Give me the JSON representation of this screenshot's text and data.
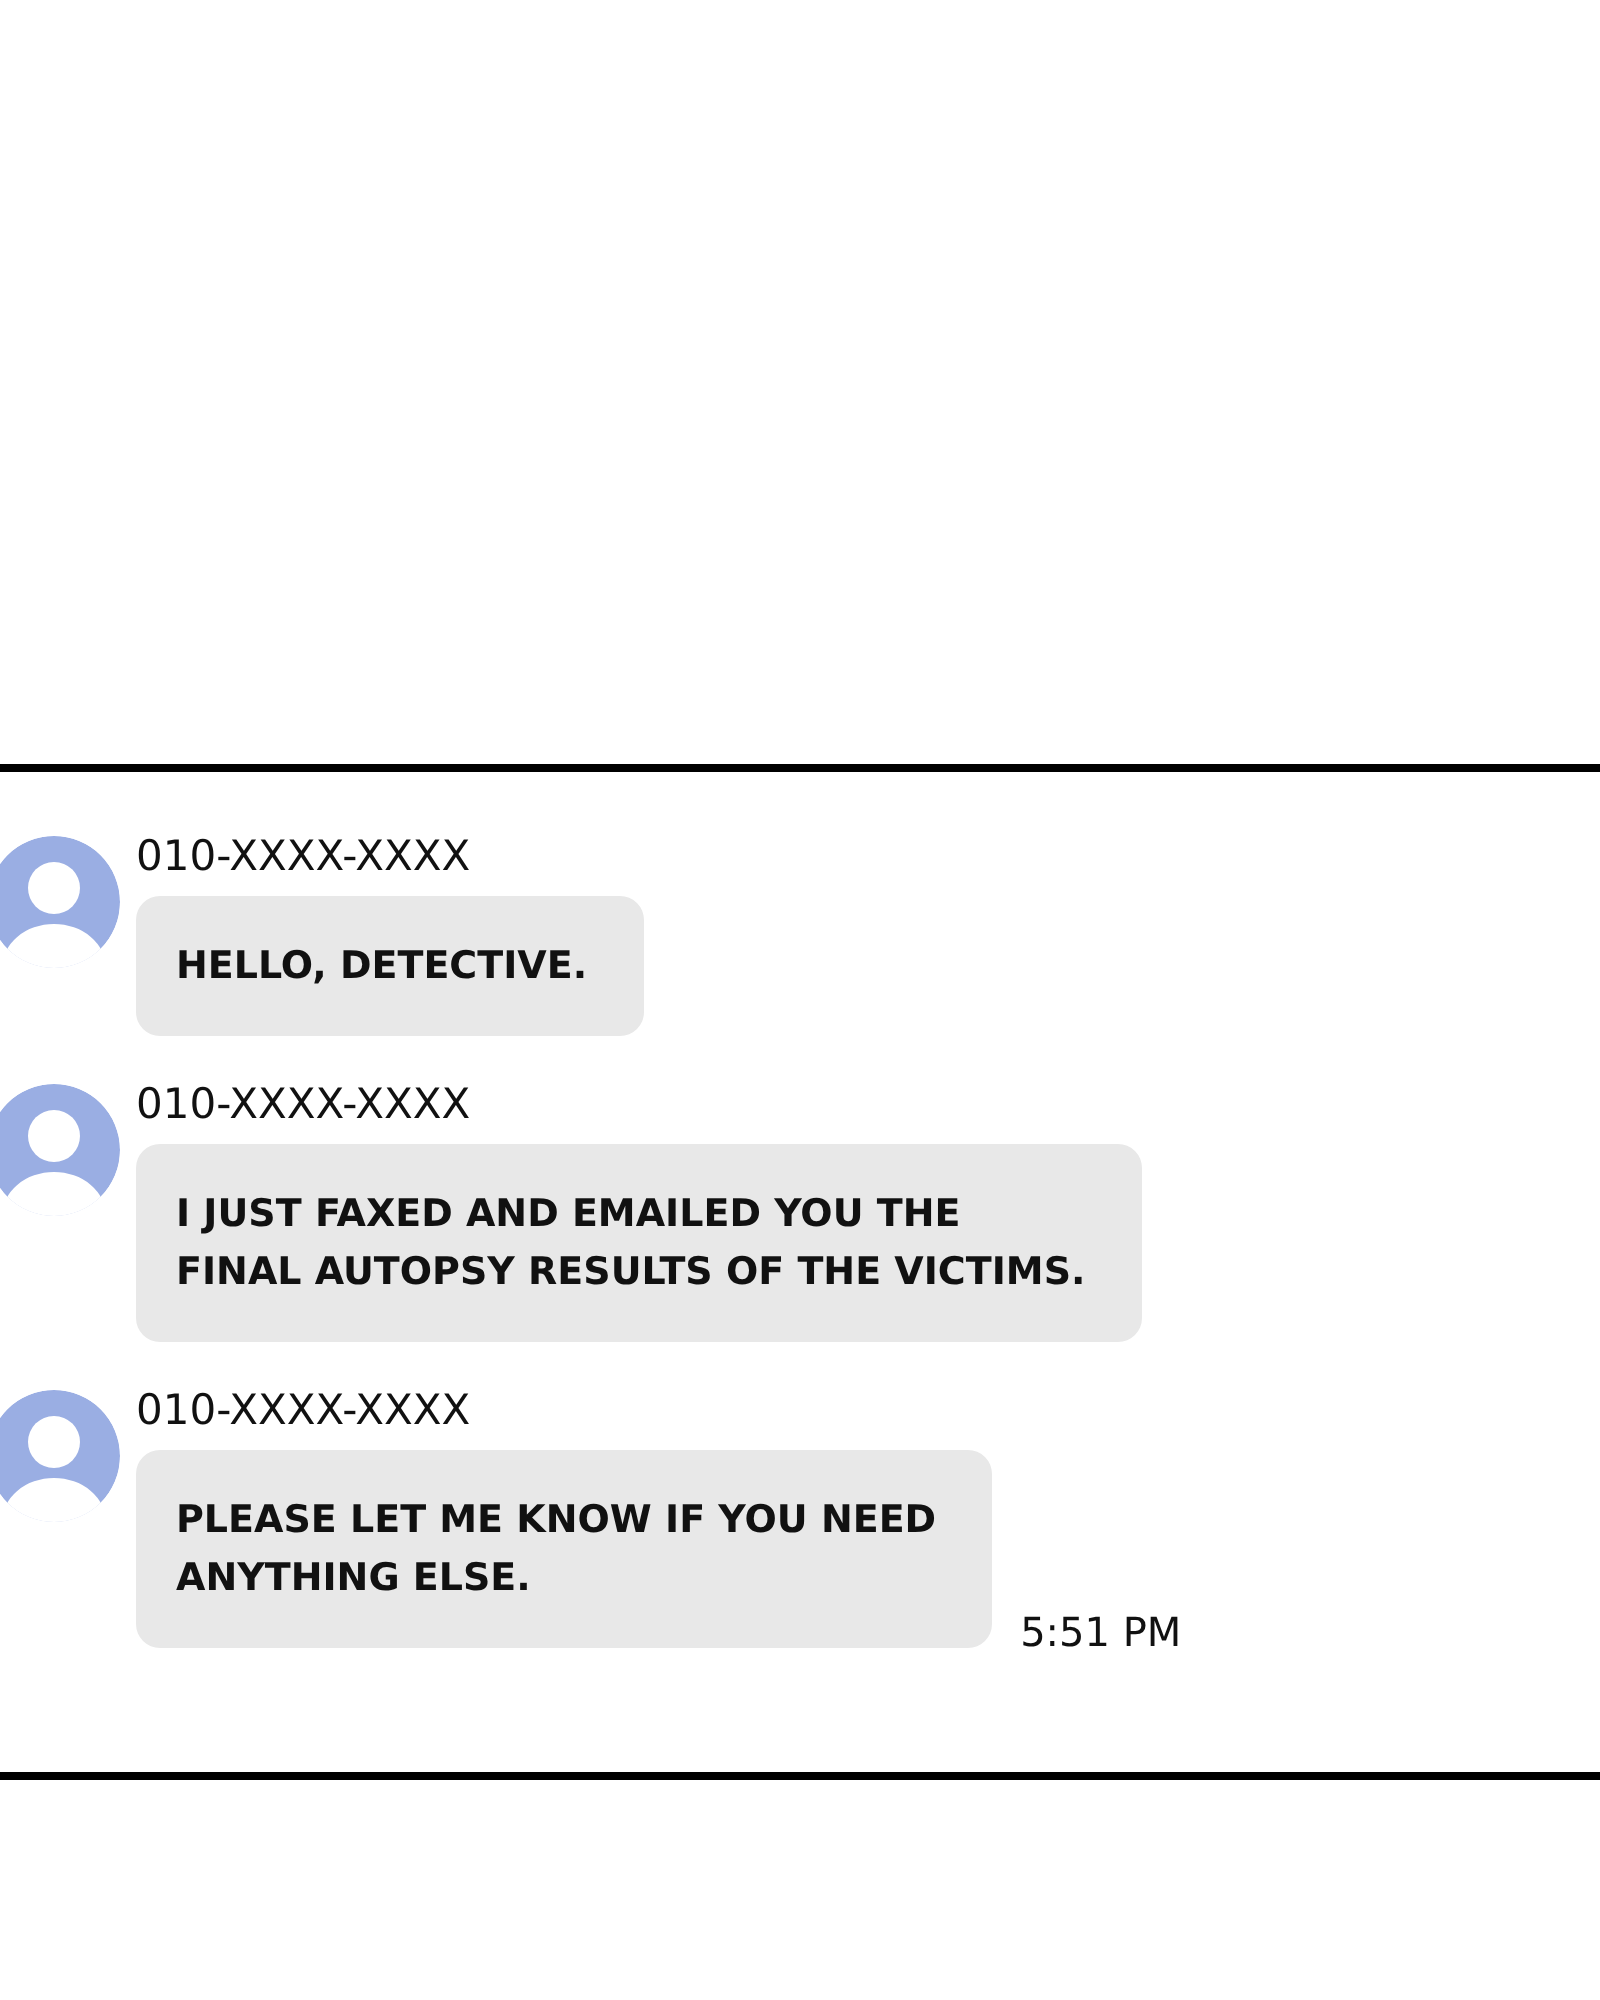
{
  "messages": [
    {
      "sender": "010-XXXX-XXXX",
      "lines": [
        "HELLO, DETECTIVE."
      ]
    },
    {
      "sender": "010-XXXX-XXXX",
      "lines": [
        "I JUST FAXED AND EMAILED YOU THE",
        "FINAL AUTOPSY RESULTS OF THE VICTIMS."
      ]
    },
    {
      "sender": "010-XXXX-XXXX",
      "lines": [
        "PLEASE LET ME KNOW IF YOU NEED",
        "ANYTHING ELSE."
      ],
      "time": "5:51 PM"
    }
  ]
}
